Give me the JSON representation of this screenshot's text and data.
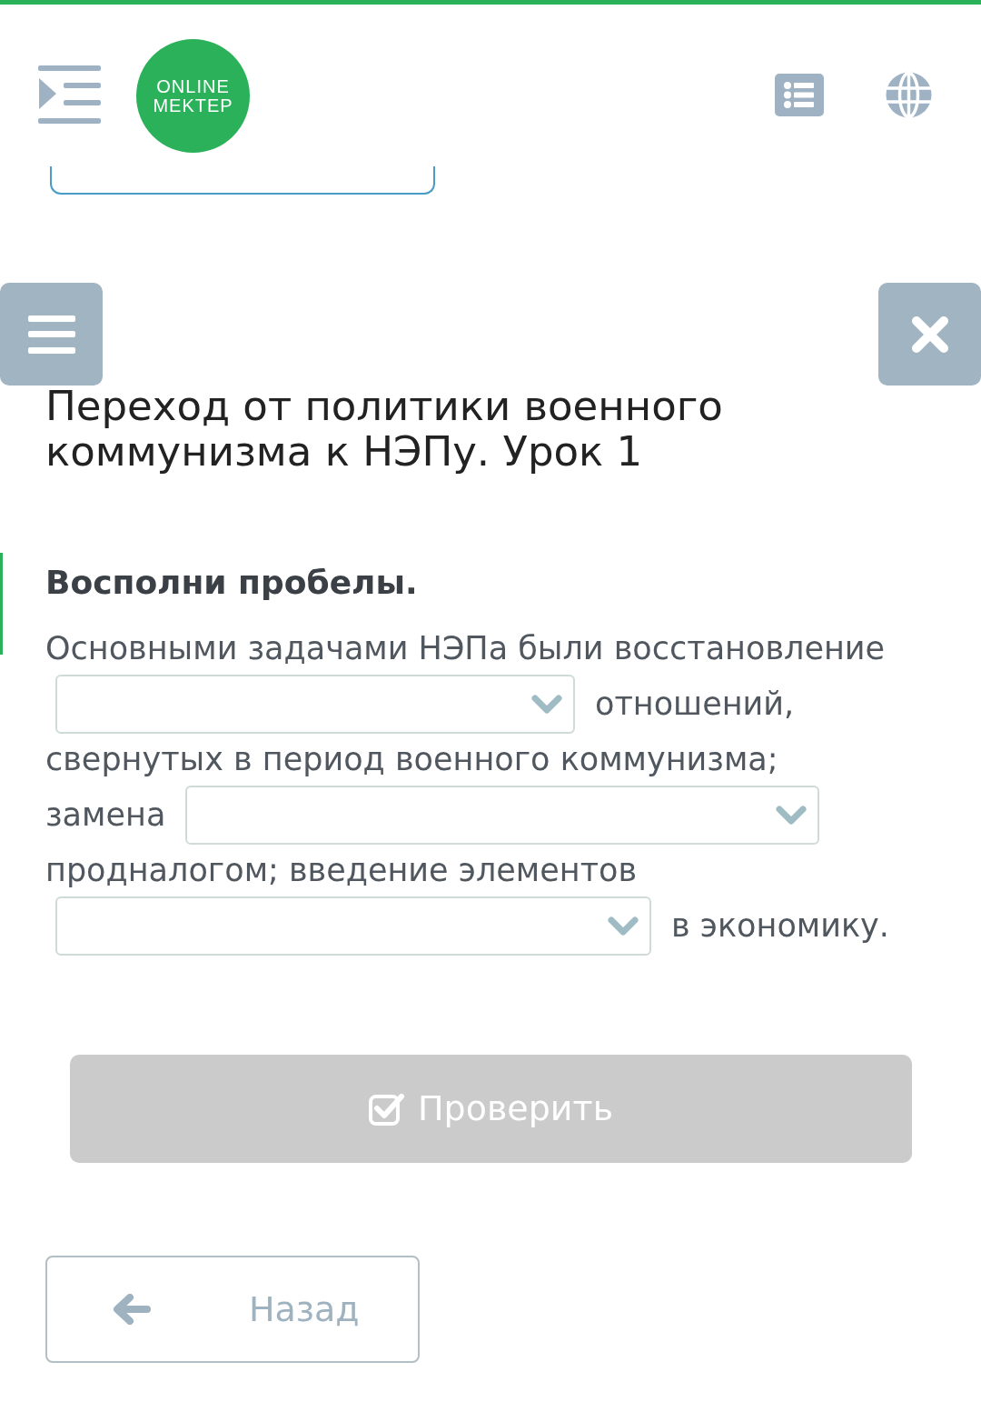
{
  "header": {
    "logo_lines": [
      "ONLINE",
      "MEKTEP"
    ]
  },
  "lesson_title": "Переход от политики военного коммунизма к НЭПу. Урок 1",
  "task": {
    "instruction": "Восполни пробелы.",
    "lines": [
      [
        {
          "kind": "text",
          "text": "Основными задачами НЭПа были восстановление"
        }
      ],
      [
        {
          "kind": "dropdown"
        },
        {
          "kind": "text",
          "text": "отношений,"
        }
      ],
      [
        {
          "kind": "text",
          "text": "свернутых в период военного коммунизма;"
        }
      ],
      [
        {
          "kind": "text",
          "text": "замена"
        },
        {
          "kind": "dropdown"
        }
      ],
      [
        {
          "kind": "text",
          "text": "продналогом; введение элементов"
        }
      ],
      [
        {
          "kind": "dropdown"
        },
        {
          "kind": "text",
          "text": "в экономику."
        }
      ]
    ]
  },
  "check_button": {
    "label": "Проверить",
    "disabled": true
  },
  "back_button": {
    "label": "Назад"
  }
}
